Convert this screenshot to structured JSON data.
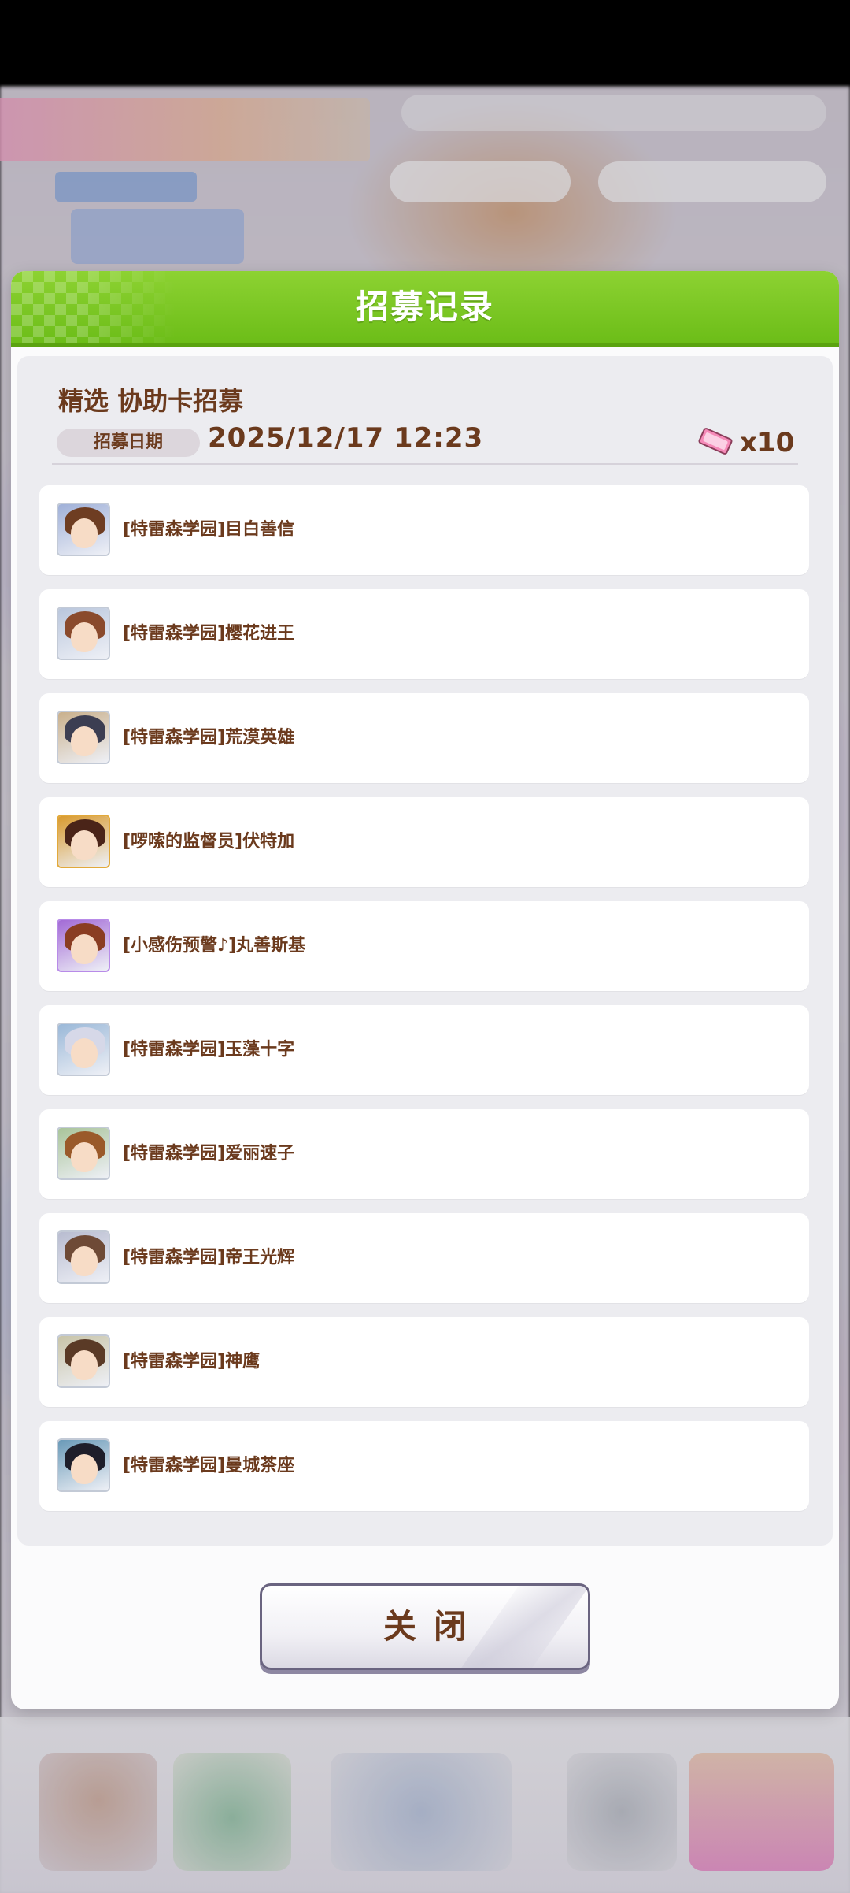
{
  "dialog": {
    "title": "招募记录",
    "gacha_name": "精选  协助卡招募",
    "date_label": "招募日期",
    "date_value": "2025/12/17  12:23",
    "ticket_count": "x10",
    "close_label": "关闭"
  },
  "cards": [
    {
      "name": "[特雷森学园]目白善信",
      "frame": "silver",
      "hair": "#6e3d22",
      "bg": "#9fb0d8"
    },
    {
      "name": "[特雷森学园]樱花进王",
      "frame": "silver",
      "hair": "#8a4a2c",
      "bg": "#b9c6dc"
    },
    {
      "name": "[特雷森学园]荒漠英雄",
      "frame": "silver",
      "hair": "#3c3e52",
      "bg": "#c9b08c"
    },
    {
      "name": "[啰嗦的监督员]伏特加",
      "frame": "gold",
      "hair": "#4a2418",
      "bg": "#d99a2e"
    },
    {
      "name": "[小感伤预警♪]丸善斯基",
      "frame": "rainbow",
      "hair": "#8a3d22",
      "bg": "#a26ad6"
    },
    {
      "name": "[特雷森学园]玉藻十字",
      "frame": "silver",
      "hair": "#d6d8e8",
      "bg": "#9ab8d8"
    },
    {
      "name": "[特雷森学园]爱丽速子",
      "frame": "silver",
      "hair": "#9a5a2a",
      "bg": "#a9c49a"
    },
    {
      "name": "[特雷森学园]帝王光辉",
      "frame": "silver",
      "hair": "#6e4a36",
      "bg": "#b8bcd0"
    },
    {
      "name": "[特雷森学园]神鹰",
      "frame": "silver",
      "hair": "#5a3a26",
      "bg": "#c8c4a8"
    },
    {
      "name": "[特雷森学园]曼城茶座",
      "frame": "silver",
      "hair": "#1e1e2a",
      "bg": "#6a9ab8"
    }
  ],
  "colors": {
    "header_green": "#6cbd18",
    "text_brown": "#6b3a1d",
    "ticket_pink": "#f58ab8"
  }
}
